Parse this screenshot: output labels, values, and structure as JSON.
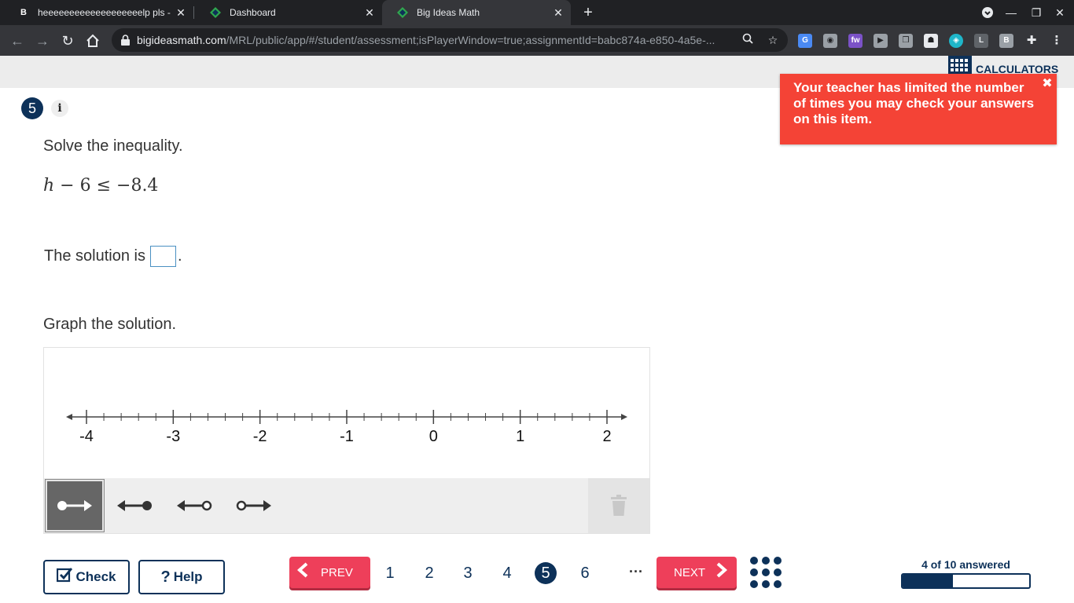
{
  "browser": {
    "tabs": [
      {
        "title": "heeeeeeeeeeeeeeeeeeelp pls - Bra",
        "favicon": "brainly-icon"
      },
      {
        "title": "Dashboard",
        "favicon": "big-ideas-icon"
      },
      {
        "title": "Big Ideas Math",
        "favicon": "big-ideas-icon"
      }
    ],
    "url_domain": "bigideasmath.com",
    "url_path": "/MRL/public/app/#/student/assessment;isPlayerWindow=true;assignmentId=babc874a-e850-4a5e-..."
  },
  "header": {
    "calculators_label": "CALCULATORS"
  },
  "toast": {
    "message": "Your teacher has limited the number of times you may check your answers on this item.",
    "close_label": "✖"
  },
  "question": {
    "number": "5",
    "info_label": "i",
    "instruction": "Solve the inequality.",
    "equation": {
      "var": "h",
      "rest": " − 6 ≤ −8.4"
    },
    "solution_prefix": "The solution is",
    "solution_suffix": ".",
    "answer_value": "",
    "graph_prompt": "Graph the solution."
  },
  "number_line": {
    "min": -4,
    "max": 2,
    "minor_step": 0.2,
    "labels": [
      "-4",
      "-3",
      "-2",
      "-1",
      "0",
      "1",
      "2"
    ]
  },
  "graph_tools": [
    {
      "name": "closed-ray-right-tool",
      "selected": true
    },
    {
      "name": "closed-ray-left-tool",
      "selected": false
    },
    {
      "name": "open-ray-left-tool",
      "selected": false
    },
    {
      "name": "open-ray-right-tool",
      "selected": false
    }
  ],
  "footer": {
    "check_label": "Check",
    "help_label": "Help",
    "prev_label": "PREV",
    "next_label": "NEXT",
    "pages": [
      "1",
      "2",
      "3",
      "4",
      "5",
      "6"
    ],
    "current_page": "5",
    "more_label": "···",
    "progress_label": "4 of 10 answered",
    "answered": 4,
    "total": 10
  },
  "colors": {
    "navy": "#0d3159",
    "accent_red": "#ee3f5a",
    "toast_red": "#f44336"
  }
}
